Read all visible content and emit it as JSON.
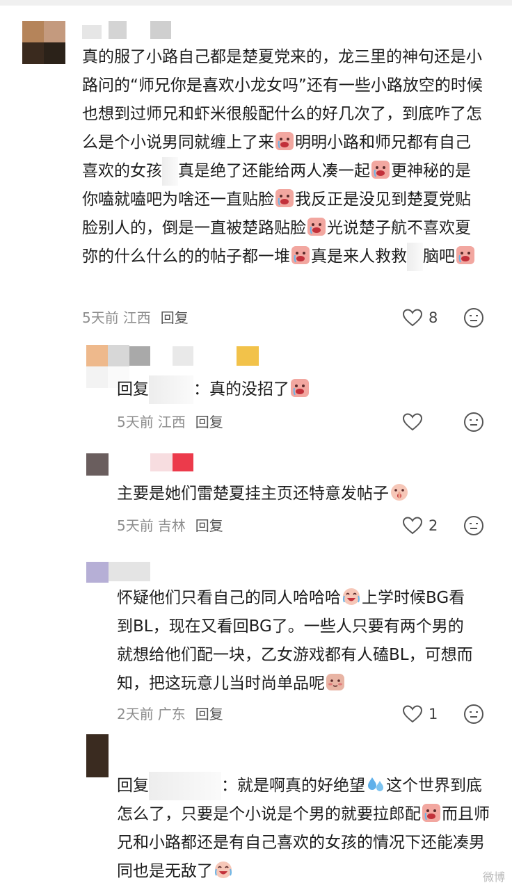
{
  "comments": [
    {
      "text": "真的服了小路自己都是楚夏党来的，龙三里的神句还是小路问的“师兄你是喜欢小龙女吗”还有一些小路放空的时候也想到过师兄和虾米很般配什么的好几次了，到底咋了怎么是个小说男同就缠上了来",
      "text_b": "明明小路和师兄都有自己喜欢的女孩",
      "text_c": "真是绝了还能给两人凑一起",
      "text_d": "更神秘的是你嗑就嗑吧为啥还一直贴脸",
      "text_e": "我反正是没见到楚夏党贴脸别人的，倒是一直被楚路贴脸",
      "text_f": "光说楚子航不喜欢夏弥的什么什么的的帖子都一堆",
      "text_g": "真是来人救救",
      "text_h": "脑吧",
      "time": "5天前",
      "location": "江西",
      "reply_label": "回复",
      "likes": "8"
    },
    {
      "prefix": "回复",
      "colon": "：",
      "text": "真的没招了",
      "time": "5天前",
      "location": "江西",
      "reply_label": "回复",
      "likes": ""
    },
    {
      "text": "主要是她们雷楚夏挂主页还特意发帖子",
      "time": "5天前",
      "location": "吉林",
      "reply_label": "回复",
      "likes": "2"
    },
    {
      "text_a": "怀疑他们只看自己的同人哈哈哈",
      "text_b": "上学时候BG看到BL，现在又看回BG了。一些人只要有两个男的就想给他们配一块，乙女游戏都有人磕BL，可想而知，把这玩意儿当时尚单品呢",
      "time": "2天前",
      "location": "广东",
      "reply_label": "回复",
      "likes": "1"
    },
    {
      "prefix": "回复",
      "colon": "：",
      "text_a": "就是啊真的好绝望",
      "text_b": "这个世界到底怎么了，只要是个小说是个男的就要拉郎配",
      "text_c": "而且师兄和小路都还是有自己喜欢的女孩的情况下还能凑男同也是无敌了"
    }
  ],
  "watermark": "微博",
  "colors": {
    "text": "#1c1c1c",
    "meta": "#8e8e8e",
    "icon": "#555555"
  }
}
